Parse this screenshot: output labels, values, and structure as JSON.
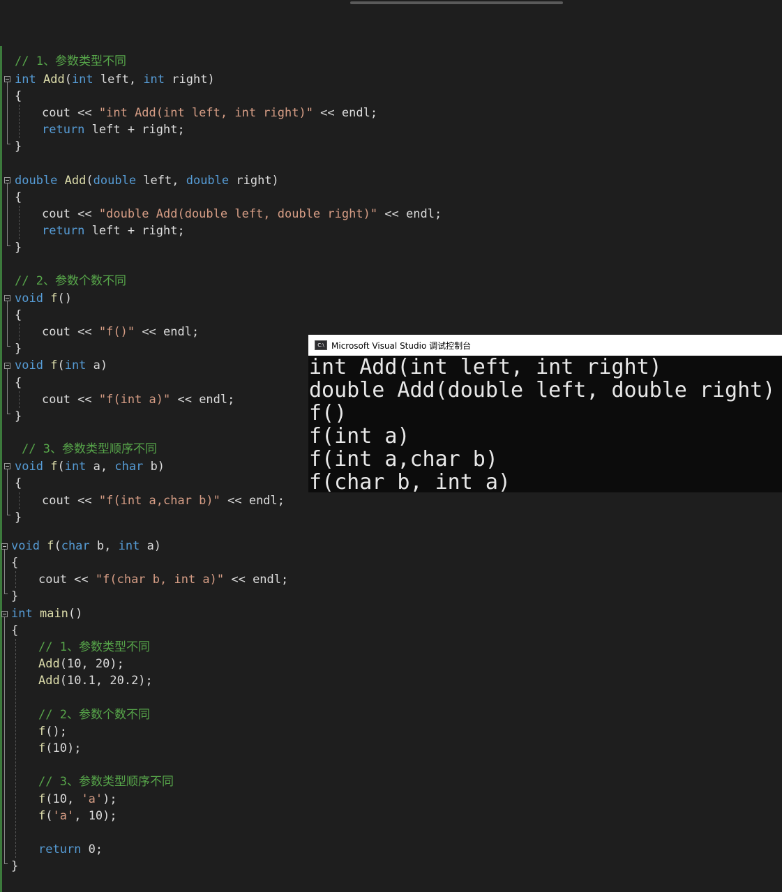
{
  "console": {
    "title": "Microsoft Visual Studio 调试控制台",
    "icon": "console-app-icon",
    "output": [
      "int Add(int left, int right)",
      "double Add(double left, double right)",
      "f()",
      "f(int a)",
      "f(int a,char b)",
      "f(char b, int a)"
    ]
  },
  "editor": {
    "colors": {
      "keyword": "#569cd6",
      "function": "#dcdcaa",
      "string": "#d69d85",
      "comment": "#57a64a",
      "text": "#dcdcdc"
    },
    "lines": [
      [
        {
          "t": "// 1、参数类型不同",
          "c": "cm"
        }
      ],
      [
        {
          "t": "int",
          "c": "kw"
        },
        {
          "t": " "
        },
        {
          "t": "Add",
          "c": "fn"
        },
        {
          "t": "("
        },
        {
          "t": "int",
          "c": "kw"
        },
        {
          "t": " left, "
        },
        {
          "t": "int",
          "c": "kw"
        },
        {
          "t": " right)"
        }
      ],
      [
        {
          "t": "{"
        }
      ],
      [
        {
          "t": "cout << "
        },
        {
          "t": "\"int Add(int left, int right)\"",
          "c": "str"
        },
        {
          "t": " << endl;"
        }
      ],
      [
        {
          "t": "return",
          "c": "kw"
        },
        {
          "t": " left + right;"
        }
      ],
      [
        {
          "t": "}"
        }
      ],
      [
        {
          "t": "double",
          "c": "kw"
        },
        {
          "t": " "
        },
        {
          "t": "Add",
          "c": "fn"
        },
        {
          "t": "("
        },
        {
          "t": "double",
          "c": "kw"
        },
        {
          "t": " left, "
        },
        {
          "t": "double",
          "c": "kw"
        },
        {
          "t": " right)"
        }
      ],
      [
        {
          "t": "{"
        }
      ],
      [
        {
          "t": "cout << "
        },
        {
          "t": "\"double Add(double left, double right)\"",
          "c": "str"
        },
        {
          "t": " << endl;"
        }
      ],
      [
        {
          "t": "return",
          "c": "kw"
        },
        {
          "t": " left + right;"
        }
      ],
      [
        {
          "t": "}"
        }
      ],
      [
        {
          "t": "// 2、参数个数不同",
          "c": "cm"
        }
      ],
      [
        {
          "t": "void",
          "c": "kw"
        },
        {
          "t": " "
        },
        {
          "t": "f",
          "c": "fn"
        },
        {
          "t": "()"
        }
      ],
      [
        {
          "t": "{"
        }
      ],
      [
        {
          "t": "cout << "
        },
        {
          "t": "\"f()\"",
          "c": "str"
        },
        {
          "t": " << endl;"
        }
      ],
      [
        {
          "t": "}"
        }
      ],
      [
        {
          "t": "void",
          "c": "kw"
        },
        {
          "t": " "
        },
        {
          "t": "f",
          "c": "fn"
        },
        {
          "t": "("
        },
        {
          "t": "int",
          "c": "kw"
        },
        {
          "t": " a)"
        }
      ],
      [
        {
          "t": "{"
        }
      ],
      [
        {
          "t": "cout << "
        },
        {
          "t": "\"f(int a)\"",
          "c": "str"
        },
        {
          "t": " << endl;"
        }
      ],
      [
        {
          "t": "}"
        }
      ],
      [
        {
          "t": "// 3、参数类型顺序不同",
          "c": "cm"
        }
      ],
      [
        {
          "t": "void",
          "c": "kw"
        },
        {
          "t": " "
        },
        {
          "t": "f",
          "c": "fn"
        },
        {
          "t": "("
        },
        {
          "t": "int",
          "c": "kw"
        },
        {
          "t": " a, "
        },
        {
          "t": "char",
          "c": "kw"
        },
        {
          "t": " b)"
        }
      ],
      [
        {
          "t": "{"
        }
      ],
      [
        {
          "t": "cout << "
        },
        {
          "t": "\"f(int a,char b)\"",
          "c": "str"
        },
        {
          "t": " << endl;"
        }
      ],
      [
        {
          "t": "}"
        }
      ],
      [
        {
          "t": "void",
          "c": "kw"
        },
        {
          "t": " "
        },
        {
          "t": "f",
          "c": "fn"
        },
        {
          "t": "("
        },
        {
          "t": "char",
          "c": "kw"
        },
        {
          "t": " b, "
        },
        {
          "t": "int",
          "c": "kw"
        },
        {
          "t": " a)"
        }
      ],
      [
        {
          "t": "{"
        }
      ],
      [
        {
          "t": "cout << "
        },
        {
          "t": "\"f(char b, int a)\"",
          "c": "str"
        },
        {
          "t": " << endl;"
        }
      ],
      [
        {
          "t": "}"
        }
      ],
      [
        {
          "t": "int",
          "c": "kw"
        },
        {
          "t": " "
        },
        {
          "t": "main",
          "c": "fn"
        },
        {
          "t": "()"
        }
      ],
      [
        {
          "t": "{"
        }
      ],
      [
        {
          "t": "// 1、参数类型不同",
          "c": "cm"
        }
      ],
      [
        {
          "t": "Add",
          "c": "fn"
        },
        {
          "t": "(10, 20);"
        }
      ],
      [
        {
          "t": "Add",
          "c": "fn"
        },
        {
          "t": "(10.1, 20.2);"
        }
      ],
      [
        {
          "t": "// 2、参数个数不同",
          "c": "cm"
        }
      ],
      [
        {
          "t": "f",
          "c": "fn"
        },
        {
          "t": "();"
        }
      ],
      [
        {
          "t": "f",
          "c": "fn"
        },
        {
          "t": "(10);"
        }
      ],
      [
        {
          "t": "// 3、参数类型顺序不同",
          "c": "cm"
        }
      ],
      [
        {
          "t": "f",
          "c": "fn"
        },
        {
          "t": "(10, "
        },
        {
          "t": "'a'",
          "c": "str"
        },
        {
          "t": ");"
        }
      ],
      [
        {
          "t": "f",
          "c": "fn"
        },
        {
          "t": "("
        },
        {
          "t": "'a'",
          "c": "str"
        },
        {
          "t": ", 10);"
        }
      ],
      [
        {
          "t": "return",
          "c": "kw"
        },
        {
          "t": " 0;"
        }
      ],
      [
        {
          "t": "}"
        }
      ]
    ]
  }
}
